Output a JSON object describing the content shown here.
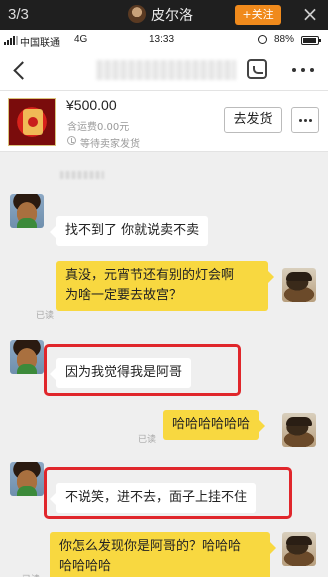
{
  "overlay": {
    "page_indicator": "3/3",
    "author_name": "皮尔洛",
    "follow_label": "+关注",
    "close_glyph": "×",
    "avatar_icon": "user-avatar-icon"
  },
  "status_bar": {
    "carrier": "中国联通",
    "network": "4G",
    "time": "13:33",
    "battery": "88%",
    "icons": [
      "signal-icon",
      "alarm-icon",
      "battery-icon"
    ]
  },
  "nav": {
    "back_icon": "chevron-left-icon",
    "call_icon": "phone-call-icon",
    "more_icon": "more-dots-icon"
  },
  "product": {
    "price": "¥500.00",
    "shipping": "含运费0.00元",
    "status": "等待卖家发货",
    "ship_button": "去发货"
  },
  "chat": {
    "messages": [
      {
        "side": "in",
        "text": "找不到了 你就说卖不卖"
      },
      {
        "side": "out",
        "lines": [
          "真没，元宵节还有别的灯会啊",
          "为啥一定要去故宫？"
        ],
        "read": "已读"
      },
      {
        "side": "in",
        "text": "因为我觉得我是阿哥",
        "highlighted": true
      },
      {
        "side": "out",
        "text": "哈哈哈哈哈哈",
        "read": "已读"
      },
      {
        "side": "in",
        "text": "不说笑，进不去，面子上挂不住",
        "highlighted": true
      },
      {
        "side": "out",
        "lines": [
          "你怎么发现你是阿哥的？哈哈哈",
          "哈哈哈哈"
        ],
        "read": "已读"
      }
    ]
  },
  "colors": {
    "incoming_bubble": "#ffffff",
    "outgoing_bubble": "#f8d840",
    "highlight_border": "#e0262b",
    "follow_button": "#f08a1c"
  }
}
